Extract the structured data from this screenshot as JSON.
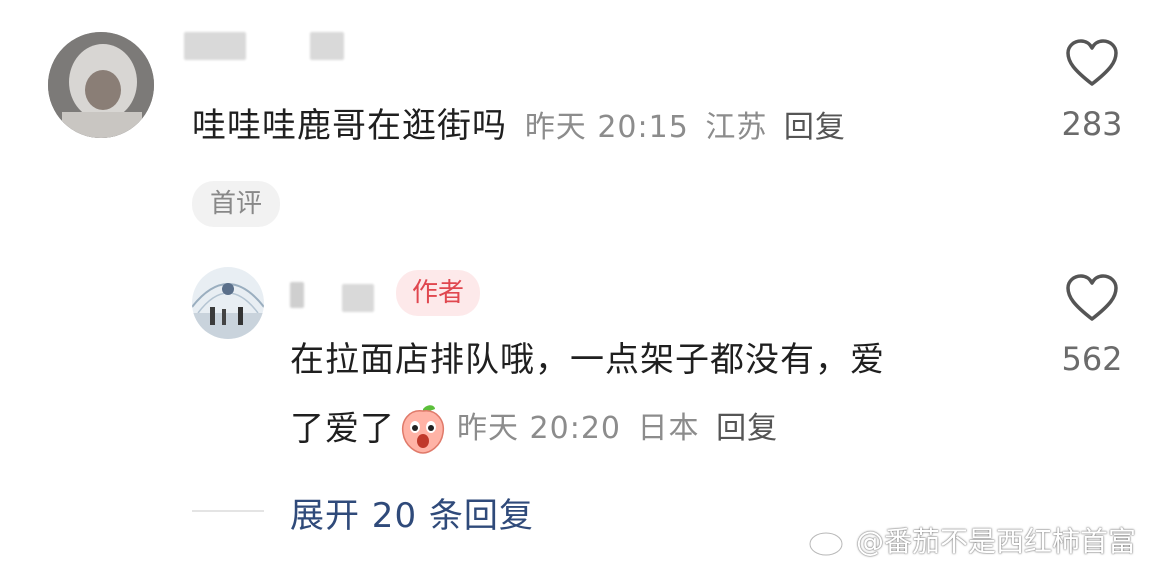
{
  "comment1": {
    "text": "哇哇哇鹿哥在逛街吗",
    "time": "昨天 20:15",
    "location": "江苏",
    "reply_label": "回复",
    "likes": "283",
    "badge": "首评"
  },
  "comment2": {
    "author_badge": "作者",
    "text_line1": "在拉面店排队哦，一点架子都没有，爱",
    "text_line2": "了爱了",
    "time": "昨天 20:20",
    "location": "日本",
    "reply_label": "回复",
    "likes": "562"
  },
  "expand_replies": "展开 20 条回复",
  "watermark": "@番茄不是西红柿首富",
  "icons": {
    "like": "heart-outline-icon",
    "emoji": "peach-surprised-emoji-icon",
    "weibo": "weibo-logo-icon"
  },
  "colors": {
    "author_badge_text": "#e0474f",
    "author_badge_bg": "#fde9ea",
    "expand_link": "#2f4a7a"
  }
}
